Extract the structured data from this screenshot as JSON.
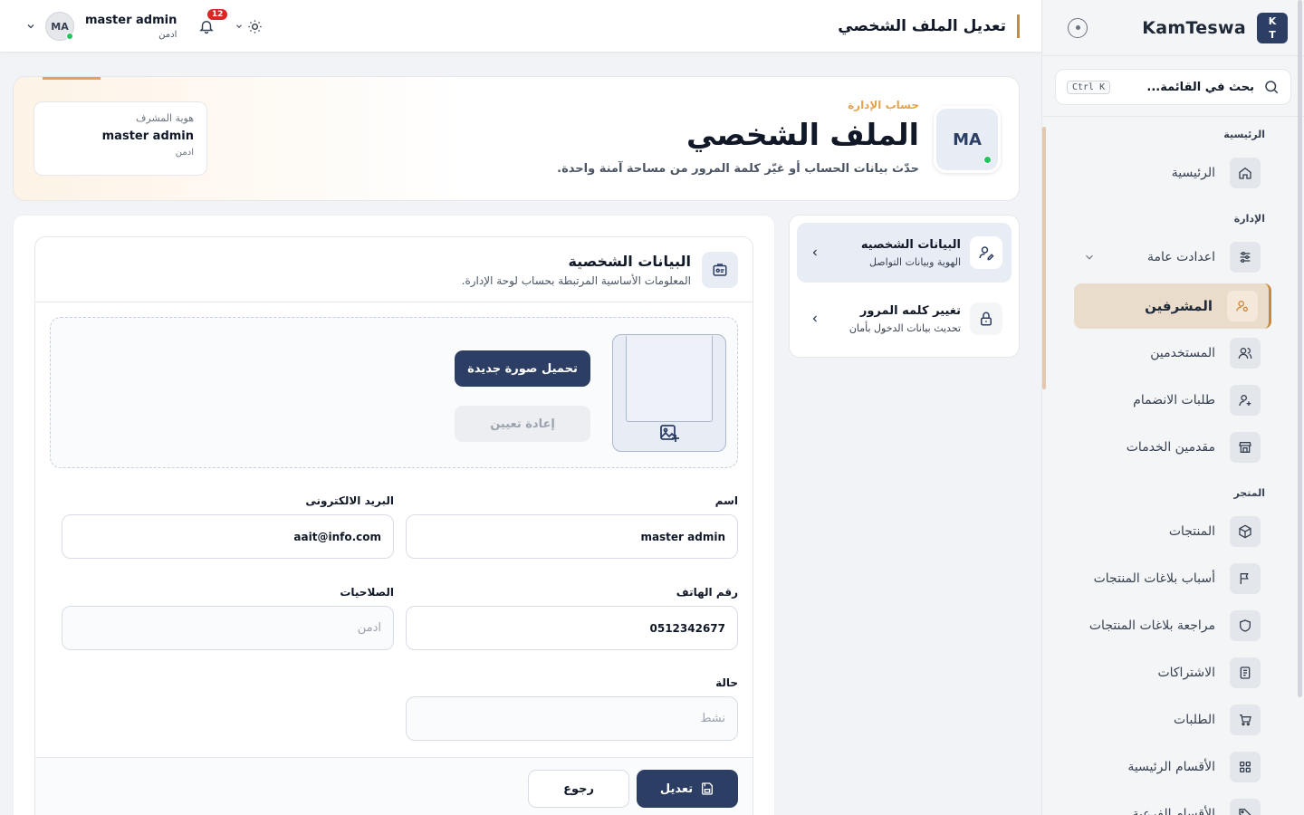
{
  "sidebar": {
    "logo_line1": "K",
    "logo_line2": "T",
    "brand": "KamTeswa",
    "search_placeholder": "بحث في القائمة...",
    "search_shortcut": "Ctrl K",
    "sections": {
      "home": "الرئيسية",
      "admin": "الإدارة",
      "store": "المتجر"
    },
    "items": {
      "home": "الرئيسية",
      "general_settings": "اعدادت عامة",
      "supervisors": "المشرفين",
      "users": "المستخدمين",
      "join_requests": "طلبات الانضمام",
      "service_providers": "مقدمين الخدمات",
      "products": "المنتجات",
      "report_reasons": "أسباب بلاغات المنتجات",
      "report_review": "مراجعة بلاغات المنتجات",
      "subscriptions": "الاشتراكات",
      "orders": "الطلبات",
      "main_categories": "الأقسام الرئيسية",
      "sub_categories": "الأقسام الفرعية"
    },
    "active_item": "supervisors",
    "accent": "#c7893f"
  },
  "topbar": {
    "page_title": "تعديل الملف الشخصي",
    "user_initials": "MA",
    "user_name": "master admin",
    "user_role": "ادمن",
    "notifications_count": "12"
  },
  "hero": {
    "eyebrow": "حساب الإدارة",
    "title": "الملف الشخصي",
    "subtitle": "حدّث بيانات الحساب أو غيّر كلمة المرور من مساحة آمنة واحدة.",
    "avatar_initials": "MA",
    "id_card": {
      "label": "هوية المشرف",
      "name": "master admin",
      "role": "ادمن"
    }
  },
  "settings_nav": {
    "personal": {
      "title": "البيانات الشخصيه",
      "subtitle": "الهوية وبيانات التواصل"
    },
    "password": {
      "title": "تغيير كلمه المرور",
      "subtitle": "تحديث بيانات الدخول بأمان"
    }
  },
  "form": {
    "title": "البيانات الشخصية",
    "subtitle": "المعلومات الأساسية المرتبطة بحساب لوحة الإدارة.",
    "upload_button": "تحميل صورة جديدة",
    "reset_button": "إعادة تعيين",
    "fields": {
      "name": {
        "label": "اسم",
        "value": "master admin"
      },
      "email": {
        "label": "البريد الالكترونى",
        "value": "aait@info.com"
      },
      "phone": {
        "label": "رقم الهاتف",
        "value": "0512342677"
      },
      "permissions": {
        "label": "الصلاحيات",
        "value": "ادمن"
      },
      "status": {
        "label": "حالة",
        "value": "نشط"
      }
    },
    "save_button": "تعديل",
    "back_button": "رجوع"
  },
  "colors": {
    "primary": "#2c3e63",
    "accent": "#c7893f",
    "hero_accent": "#e5a44b",
    "online": "#22c55e",
    "badge": "#dc2626"
  },
  "icons": {
    "search": "search-icon",
    "bell": "bell-icon",
    "sun": "sun-icon",
    "home": "home-icon",
    "sliders": "sliders-icon",
    "user": "user-icon",
    "users": "users-icon",
    "user_plus": "user-plus-icon",
    "store": "store-icon",
    "box": "box-icon",
    "flag": "flag-icon",
    "shield": "shield-icon",
    "receipt": "receipt-icon",
    "cart": "cart-icon",
    "grid": "grid-icon",
    "lock": "lock-icon",
    "id_card": "id-card-icon",
    "image_plus": "image-plus-icon",
    "save": "save-icon"
  }
}
